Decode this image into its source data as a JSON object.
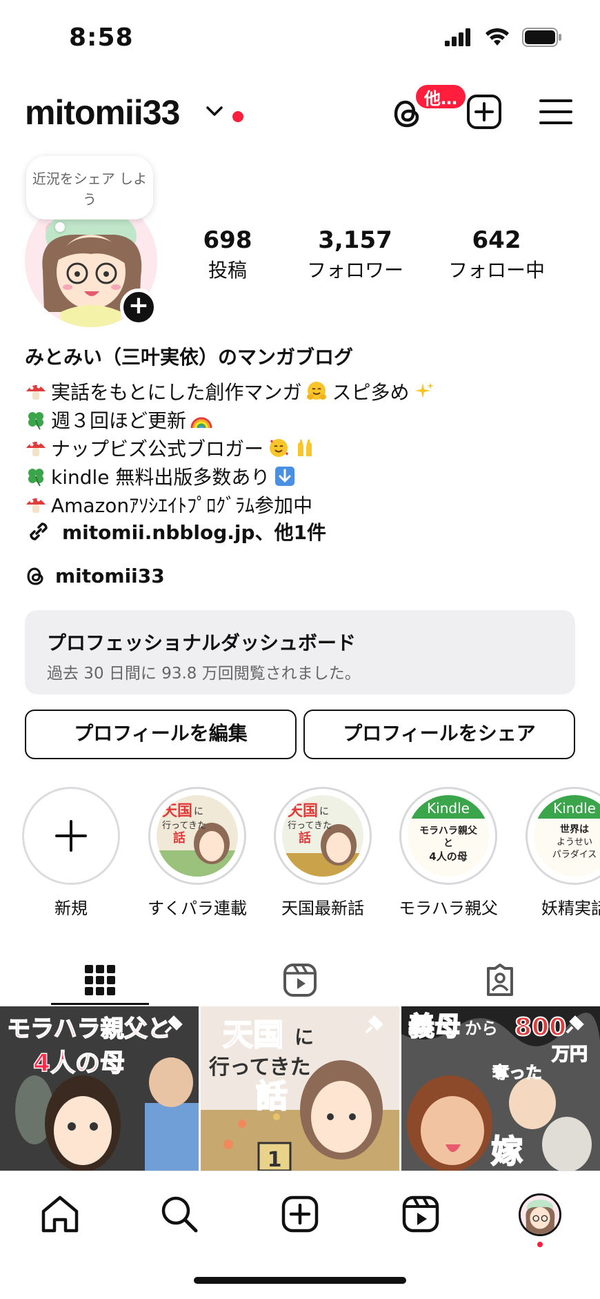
{
  "status": {
    "time": "8:58"
  },
  "header": {
    "username": "mitomii33",
    "badge": "他…"
  },
  "note": {
    "text": "近況をシェア しよう"
  },
  "stats": [
    {
      "num": "698",
      "label": "投稿"
    },
    {
      "num": "3,157",
      "label": "フォロワー"
    },
    {
      "num": "642",
      "label": "フォロー中"
    }
  ],
  "bio": {
    "name": "みとみい（三叶実依）のマンガブログ",
    "lines": [
      "実話をもとにした創作マンガ",
      "スピ多め",
      "週３回ほど更新",
      "ナップビズ公式ブロガー",
      "kindle 無料出版多数あり",
      "Amazonｱｿｼｴｲﾄﾌﾟﾛｸﾞﾗﾑ参加中"
    ],
    "link": "mitomii.nbblog.jp、他1件",
    "threads": "mitomii33"
  },
  "dashboard": {
    "title": "プロフェッショナルダッシュボード",
    "subtitle": "過去 30 日間に 93.8 万回閲覧されました。"
  },
  "buttons": {
    "edit": "プロフィールを編集",
    "share": "プロフィールをシェア"
  },
  "highlights": [
    {
      "label": "新規"
    },
    {
      "label": "すくパラ連載",
      "art1": "天国",
      "art2": "に",
      "art3": "行ってきた",
      "art4": "話"
    },
    {
      "label": "天国最新話",
      "art1": "天国",
      "art2": "に",
      "art3": "行ってきた",
      "art4": "話"
    },
    {
      "label": "モラハラ親父",
      "art1": "Kindle",
      "art2": "モラハラ親父",
      "art3": "と",
      "art4": "4人の母"
    },
    {
      "label": "妖精実話",
      "art1": "Kindle",
      "art2": "世界は",
      "art3": "ようせい",
      "art4": "パラダイス"
    }
  ],
  "posts": [
    {
      "t1": "モラハラ親父と",
      "t2": "4人の母"
    },
    {
      "t1": "天国",
      "t2": "に",
      "t3": "行ってきた",
      "t4": "話",
      "t5": "1"
    },
    {
      "t1": "義母",
      "t2": "から",
      "t3": "800",
      "t4": "万円",
      "t5": "奪った",
      "t6": "嫁"
    }
  ],
  "colors": {
    "accent_red": "#ff1e3c",
    "dash_bg": "#efeff1"
  }
}
